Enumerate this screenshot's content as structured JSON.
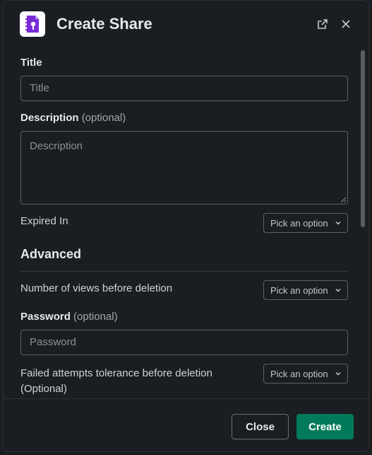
{
  "header": {
    "title": "Create Share",
    "brand_color": "#7a2bd6",
    "app_icon": "file-lock-icon",
    "open_icon": "external-link-icon",
    "close_icon": "close-icon"
  },
  "form": {
    "title_label": "Title",
    "title_placeholder": "Title",
    "description_label": "Description",
    "description_optional": "(optional)",
    "description_placeholder": "Description",
    "expired_label": "Expired In",
    "expired_value": "Pick an option",
    "advanced_heading": "Advanced",
    "views_label": "Number of views before deletion",
    "views_value": "Pick an option",
    "password_label": "Password",
    "password_optional": "(optional)",
    "password_placeholder": "Password",
    "failed_label_line1": "Failed attempts tolerance before deletion",
    "failed_label_line2": "(Optional)",
    "failed_value": "Pick an option"
  },
  "footer": {
    "close_label": "Close",
    "create_label": "Create",
    "create_color": "#007a5a"
  }
}
